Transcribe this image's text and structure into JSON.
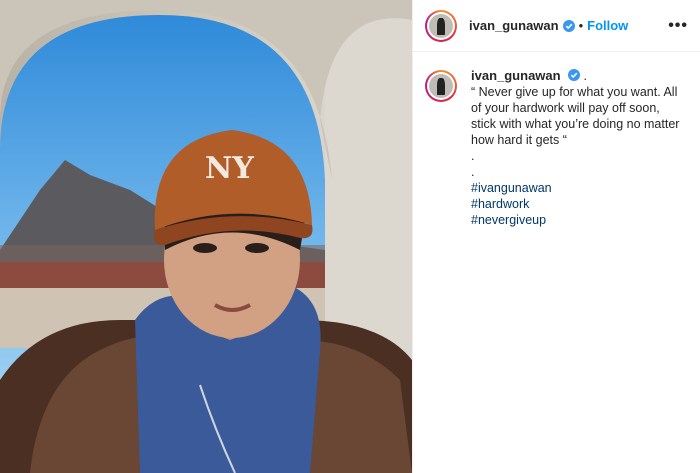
{
  "post": {
    "username": "ivan_gunawan",
    "follow_label": "Follow",
    "separator": "•",
    "more_label": "•••",
    "caption_trail": ".",
    "caption_lines": [
      "“ Never give up for what you want. All of your hardwork will pay off soon, stick with what you’re doing no matter how hard it gets “",
      ".",
      "."
    ],
    "hashtags": [
      "#ivangunawan",
      "#hardwork",
      "#nevergiveup"
    ]
  },
  "colors": {
    "link_blue": "#0095f6",
    "hashtag_blue": "#00376b",
    "sky": "#4a9fe0",
    "cap_brown": "#b15d2a",
    "hoodie_blue": "#3b5a9a",
    "fur_brown": "#4a2f22"
  },
  "icons": [
    "verified-badge-icon",
    "more-options-icon"
  ]
}
